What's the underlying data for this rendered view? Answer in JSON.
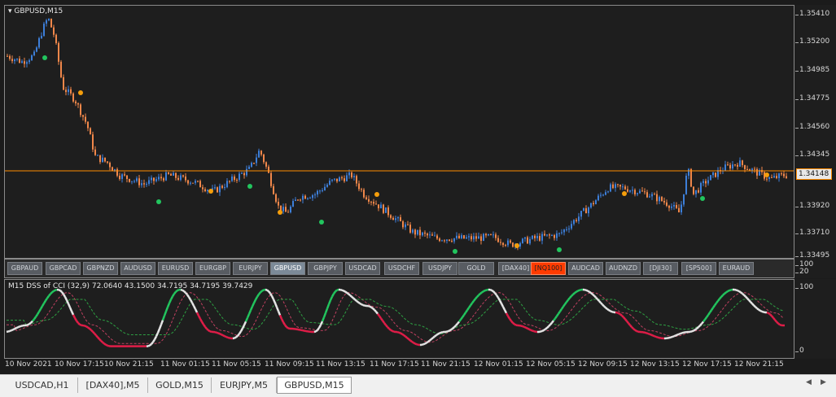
{
  "main_chart": {
    "title": "GBPUSD,M15",
    "current_price": "1.34148",
    "price_labels": [
      "1.35410",
      "1.35200",
      "1.34985",
      "1.34775",
      "1.34560",
      "1.34345",
      "1.33920",
      "1.33710",
      "1.33495"
    ],
    "colors": {
      "bull": "#3d7fd9",
      "bear": "#f0874a",
      "buy_dot": "#22c55e",
      "sell_dot": "#f59e0b",
      "price_line": "#ff8c00"
    }
  },
  "symbol_buttons": [
    "GBPAUD",
    "GBPCAD",
    "GBPNZD",
    "AUDUSD",
    "EURUSD",
    "EURGBP",
    "EURJPY",
    "GBPUSD",
    "GBPJPY",
    "USDCAD",
    "USDCHF",
    "USDJPY",
    "GOLD",
    "[DAX40]",
    "[NQ100]",
    "AUDCAD",
    "AUDNZD",
    "[DJI30]",
    "[SP500]",
    "EURAUD"
  ],
  "selected_symbol": "GBPUSD",
  "highlight_symbol": "[NQ100]",
  "button_scale": [
    "100",
    "20"
  ],
  "indicator": {
    "title": "M15 DSS of CCI (32,9) 72.0640 43.1500 34.7195 34.7195 39.7429",
    "scale": [
      "100",
      "0"
    ],
    "colors": {
      "up": "#22c55e",
      "down": "#e11d48",
      "white": "#e5e5e5"
    }
  },
  "time_labels": [
    "10 Nov 2021",
    "10 Nov 17:15",
    "10 Nov 21:15",
    "11 Nov 01:15",
    "11 Nov 05:15",
    "11 Nov 09:15",
    "11 Nov 13:15",
    "11 Nov 17:15",
    "11 Nov 21:15",
    "12 Nov 01:15",
    "12 Nov 05:15",
    "12 Nov 09:15",
    "12 Nov 13:15",
    "12 Nov 17:15",
    "12 Nov 21:15"
  ],
  "tabs": [
    "USDCAD,H1",
    "[DAX40],M5",
    "GOLD,M15",
    "EURJPY,M5",
    "GBPUSD,M15"
  ],
  "active_tab": "GBPUSD,M15"
}
